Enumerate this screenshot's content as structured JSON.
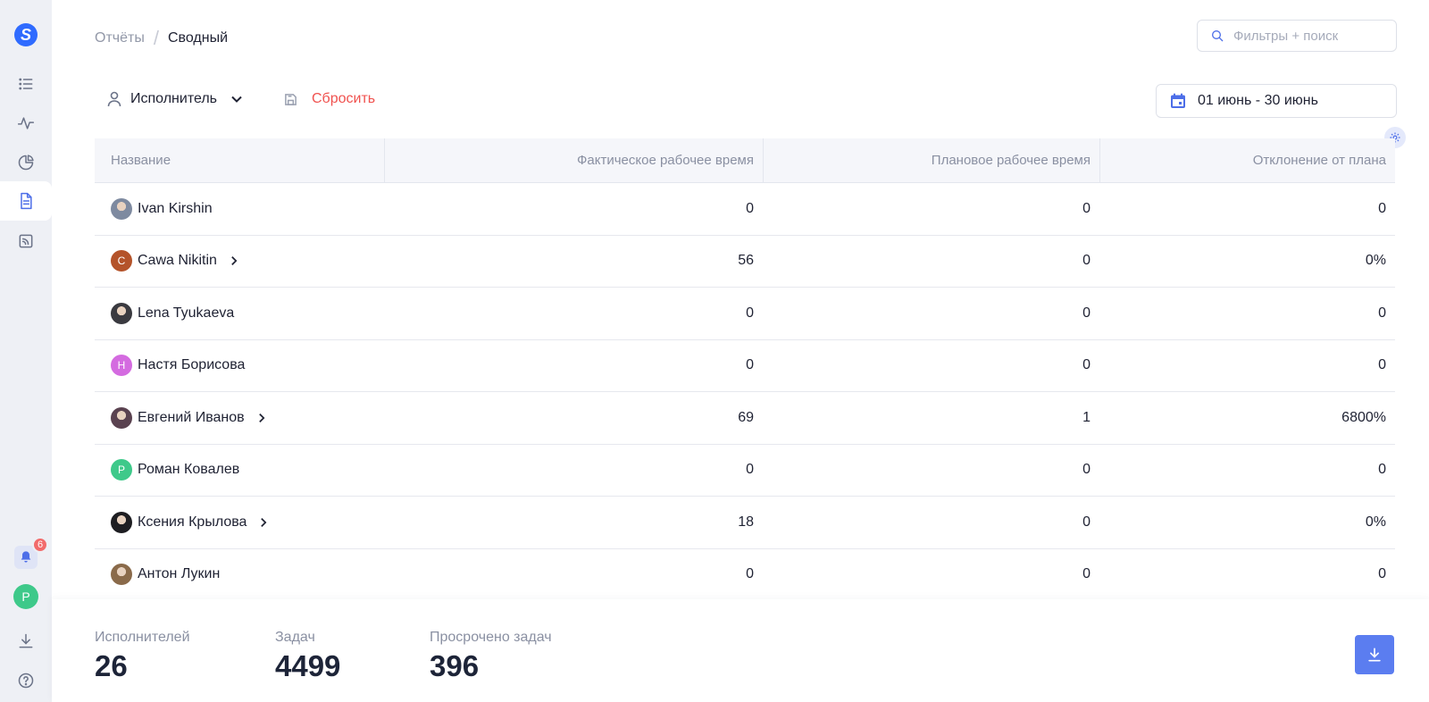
{
  "breadcrumb": {
    "root": "Отчёты",
    "separator": "/",
    "current": "Сводный"
  },
  "search": {
    "placeholder": "Фильтры + поиск"
  },
  "filters": {
    "assignee_label": "Исполнитель",
    "reset_label": "Сбросить"
  },
  "date_range": {
    "label": "01 июнь - 30 июнь"
  },
  "sidebar": {
    "notifications_count": "6",
    "user_initial": "Р",
    "icons": [
      "list-icon",
      "activity-icon",
      "pie-chart-icon",
      "document-icon",
      "rss-icon",
      "bell-icon",
      "download-icon",
      "help-icon"
    ]
  },
  "table": {
    "columns": [
      "Название",
      "Фактическое рабочее время",
      "Плановое рабочее время",
      "Отклонение от плана"
    ],
    "rows": [
      {
        "name": "Ivan Kirshin",
        "actual": "0",
        "planned": "0",
        "deviation": "0",
        "avatar": "photo",
        "color": "#7e8aa0",
        "expandable": false
      },
      {
        "name": "Cawa Nikitin",
        "actual": "56",
        "planned": "0",
        "deviation": "0%",
        "avatar": "С",
        "color": "#b4532a",
        "expandable": true
      },
      {
        "name": "Lena Tyukaeva",
        "actual": "0",
        "planned": "0",
        "deviation": "0",
        "avatar": "photo",
        "color": "#3a3a40",
        "expandable": false
      },
      {
        "name": "Настя Борисова",
        "actual": "0",
        "planned": "0",
        "deviation": "0",
        "avatar": "Н",
        "color": "#d46be0",
        "expandable": false
      },
      {
        "name": "Евгений Иванов",
        "actual": "69",
        "planned": "1",
        "deviation": "6800%",
        "avatar": "photo",
        "color": "#5a4250",
        "expandable": true
      },
      {
        "name": "Роман Ковалев",
        "actual": "0",
        "planned": "0",
        "deviation": "0",
        "avatar": "Р",
        "color": "#3ec98a",
        "expandable": false
      },
      {
        "name": "Ксения Крылова",
        "actual": "18",
        "planned": "0",
        "deviation": "0%",
        "avatar": "photo",
        "color": "#1e1e22",
        "expandable": true
      },
      {
        "name": "Антон Лукин",
        "actual": "0",
        "planned": "0",
        "deviation": "0",
        "avatar": "photo",
        "color": "#8a6a4a",
        "expandable": false
      }
    ]
  },
  "footer": {
    "stats": [
      {
        "label": "Исполнителей",
        "value": "26"
      },
      {
        "label": "Задач",
        "value": "4499"
      },
      {
        "label": "Просрочено задач",
        "value": "396"
      }
    ]
  },
  "colors": {
    "accent": "#4d6ee8",
    "danger": "#f0524f",
    "success": "#3ec98a"
  }
}
